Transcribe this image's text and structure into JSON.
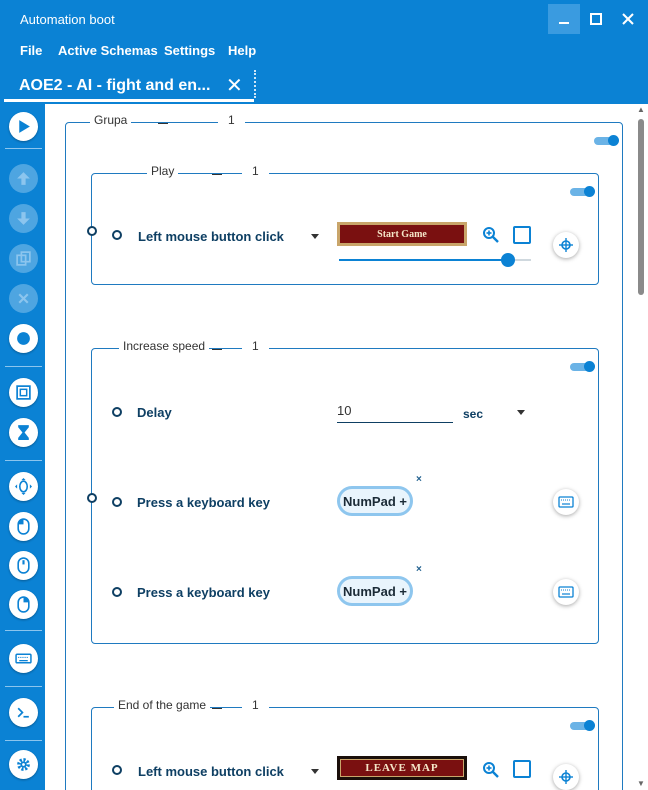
{
  "window": {
    "title": "Automation boot"
  },
  "menu": {
    "file": "File",
    "active_schemas": "Active Schemas",
    "settings": "Settings",
    "help": "Help"
  },
  "tab": {
    "label": "AOE2 - AI - fight and en..."
  },
  "outer_group": {
    "name": "Grupa",
    "count": "1"
  },
  "play_group": {
    "name": "Play",
    "count": "1",
    "step": {
      "action": "Left mouse button click",
      "image_text": "Start Game",
      "slider_value": 0.9
    }
  },
  "speed_group": {
    "name": "Increase speed",
    "count": "1",
    "delay": {
      "label": "Delay",
      "value": "10",
      "unit": "sec"
    },
    "key1": {
      "label": "Press a keyboard key",
      "key": "NumPad +",
      "remove": "×"
    },
    "key2": {
      "label": "Press a keyboard key",
      "key": "NumPad +",
      "remove": "×"
    }
  },
  "end_group": {
    "name": "End of the game",
    "count": "1",
    "step": {
      "action": "Left mouse button click",
      "image_text": "LEAVE MAP"
    }
  },
  "colors": {
    "accent": "#0b82d4",
    "text": "#0e3f63"
  }
}
